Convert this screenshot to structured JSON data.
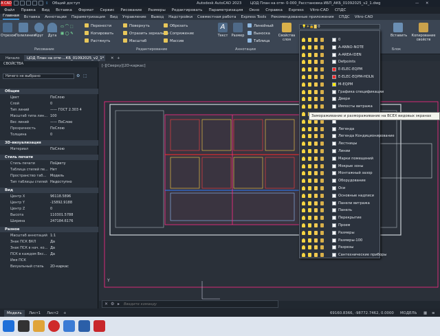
{
  "title_bar": {
    "logo": "A CAD",
    "shared_view": "Общий доступ",
    "app": "Autodesk AutoCAD 2023",
    "doc": "ЦОД План на отм- 0-000_Расстановка ИБП_АКБ_01092025_v2_1.dwg"
  },
  "menu": [
    "Файл",
    "Правка",
    "Вид",
    "Вставка",
    "Формат",
    "Сервис",
    "Рисование",
    "Размеры",
    "Редактировать",
    "Параметризация",
    "Окно",
    "Справка",
    "Express",
    "Vitro-CAD",
    "СПДС"
  ],
  "ribbon_tabs": [
    "Главная",
    "Вставка",
    "Аннотации",
    "Параметризация",
    "Вид",
    "Управление",
    "Вывод",
    "Надстройки",
    "Совместная работа",
    "Express Tools",
    "Рекомендованные приложения",
    "СПДС",
    "Vitro-CAD"
  ],
  "ribbon": {
    "draw_tools": [
      "Отрезок",
      "Полилиния",
      "Круг",
      "Дуга"
    ],
    "modify_tools": [
      "Перенести",
      "Повернуть",
      "Обрезать",
      "Копировать",
      "Отразить зеркально",
      "Сопряжение",
      "Растянуть",
      "Масштаб",
      "Массив"
    ],
    "annotation_tools": [
      "Текст",
      "Размер",
      "Линейный",
      "Выноска",
      "Таблица"
    ],
    "layer_panel_label": "Свойства слоя",
    "right_tools": [
      "Вставить",
      "Копирование свойств"
    ],
    "panels": [
      "Рисование",
      "Редактирование",
      "Аннотации",
      "Блок"
    ],
    "layer_current": "0"
  },
  "doc_tabs": {
    "start": "Начало",
    "active": "ЦОД План на отм-...КБ_01092025_v2_1*",
    "add": "+"
  },
  "properties": {
    "header": "СВОЙСТВА",
    "selection": "Ничего не выбрано",
    "sections": [
      {
        "title": "Общие",
        "rows": [
          [
            "Цвет",
            "ПоСлою"
          ],
          [
            "Слой",
            "0"
          ],
          [
            "Тип линий",
            "—— ГОСТ 2.303 4"
          ],
          [
            "Масштаб типа лин...",
            "100"
          ],
          [
            "Вес линий",
            "—— ПоСлою"
          ],
          [
            "Прозрачность",
            "ПоСлою"
          ],
          [
            "Толщина",
            "0"
          ]
        ]
      },
      {
        "title": "3D-визуализация",
        "rows": [
          [
            "Материал",
            "ПоСлою"
          ]
        ]
      },
      {
        "title": "Стиль печати",
        "rows": [
          [
            "Стиль печати",
            "ПоЦвету"
          ],
          [
            "Таблица стилей пе...",
            "Нет"
          ],
          [
            "Пространство таб...",
            "Модель"
          ],
          [
            "Тип таблицы стилей",
            "Недоступно"
          ]
        ]
      },
      {
        "title": "Вид",
        "rows": [
          [
            "Центр X",
            "96118.5896"
          ],
          [
            "Центр Y",
            "-15892.9188"
          ],
          [
            "Центр Z",
            "0"
          ],
          [
            "Высота",
            "110301.5788"
          ],
          [
            "Ширина",
            "247184.6176"
          ]
        ]
      },
      {
        "title": "Разное",
        "rows": [
          [
            "Масштаб аннотаций",
            "1:1"
          ],
          [
            "Знак ПСК ВКЛ",
            "Да"
          ],
          [
            "Знак ПСК в нач. ко...",
            "Да"
          ],
          [
            "ПСК в каждом Вкс...",
            "Да"
          ],
          [
            "Имя ПСК",
            ""
          ],
          [
            "Визуальный стиль",
            "2D-каркас"
          ]
        ]
      }
    ]
  },
  "viewport": {
    "label": "[-][Сверху][2D-каркас]",
    "axis_y": "Y"
  },
  "command": {
    "placeholder": "Введите команду"
  },
  "bottom_tabs": [
    "Модель",
    "Лист1",
    "Лист2"
  ],
  "status_bar": {
    "coords": "69160.8366, -98772.7462, 0.0000",
    "mode": "МОДЕЛЬ"
  },
  "layers": [
    {
      "name": "0",
      "color": "#ffffff"
    },
    {
      "name": "A-ANNO-NOTE",
      "color": "#ffffff"
    },
    {
      "name": "A-AREA-IDEN",
      "color": "#ffffff"
    },
    {
      "name": "Defpoints",
      "color": "#ffffff"
    },
    {
      "name": "E-ELEC-EQPM",
      "color": "#ff2a2a"
    },
    {
      "name": "E-ELEC-EQPM-HDLN",
      "color": "#ff2a2a"
    },
    {
      "name": "M-EQPM",
      "color": "#ffea00"
    },
    {
      "name": "Графика спецификации",
      "color": "#ffffff"
    },
    {
      "name": "Двери",
      "color": "#ffffff"
    },
    {
      "name": "Импосты витража",
      "color": "#ffffff"
    },
    {
      "name": "Каркас_Импост",
      "color": "#ffffff"
    },
    {
      "name": "",
      "color": "#ffffff"
    },
    {
      "name": "Легенда",
      "color": "#ffffff"
    },
    {
      "name": "Легенда Кондиционирование",
      "color": "#ffffff"
    },
    {
      "name": "Лестницы",
      "color": "#ffffff"
    },
    {
      "name": "Линии",
      "color": "#ffffff"
    },
    {
      "name": "Марки помещений",
      "color": "#ffffff"
    },
    {
      "name": "Мокрые зоны",
      "color": "#ffffff"
    },
    {
      "name": "Монтажный зазор",
      "color": "#ffffff"
    },
    {
      "name": "Оборудование",
      "color": "#ffffff"
    },
    {
      "name": "Оси",
      "color": "#ffffff"
    },
    {
      "name": "Основные надписи",
      "color": "#ffffff"
    },
    {
      "name": "Панели витража",
      "color": "#ffffff"
    },
    {
      "name": "Панель",
      "color": "#ffffff"
    },
    {
      "name": "Перекрытие",
      "color": "#ffffff"
    },
    {
      "name": "Проем",
      "color": "#ffffff"
    },
    {
      "name": "Размеры",
      "color": "#ffffff"
    },
    {
      "name": "Размеры-100",
      "color": "#ffffff"
    },
    {
      "name": "Разрезы",
      "color": "#ffffff"
    },
    {
      "name": "Сантехнические приборы",
      "color": "#ffffff"
    }
  ],
  "tooltip": "Замораживание и размораживание на ВСЕХ видовых экранах",
  "colors": {
    "accent": "#3c92d6",
    "ribbon": "#3b4553",
    "canvas": "#2a3039",
    "selection_border": "#ff2a86"
  }
}
